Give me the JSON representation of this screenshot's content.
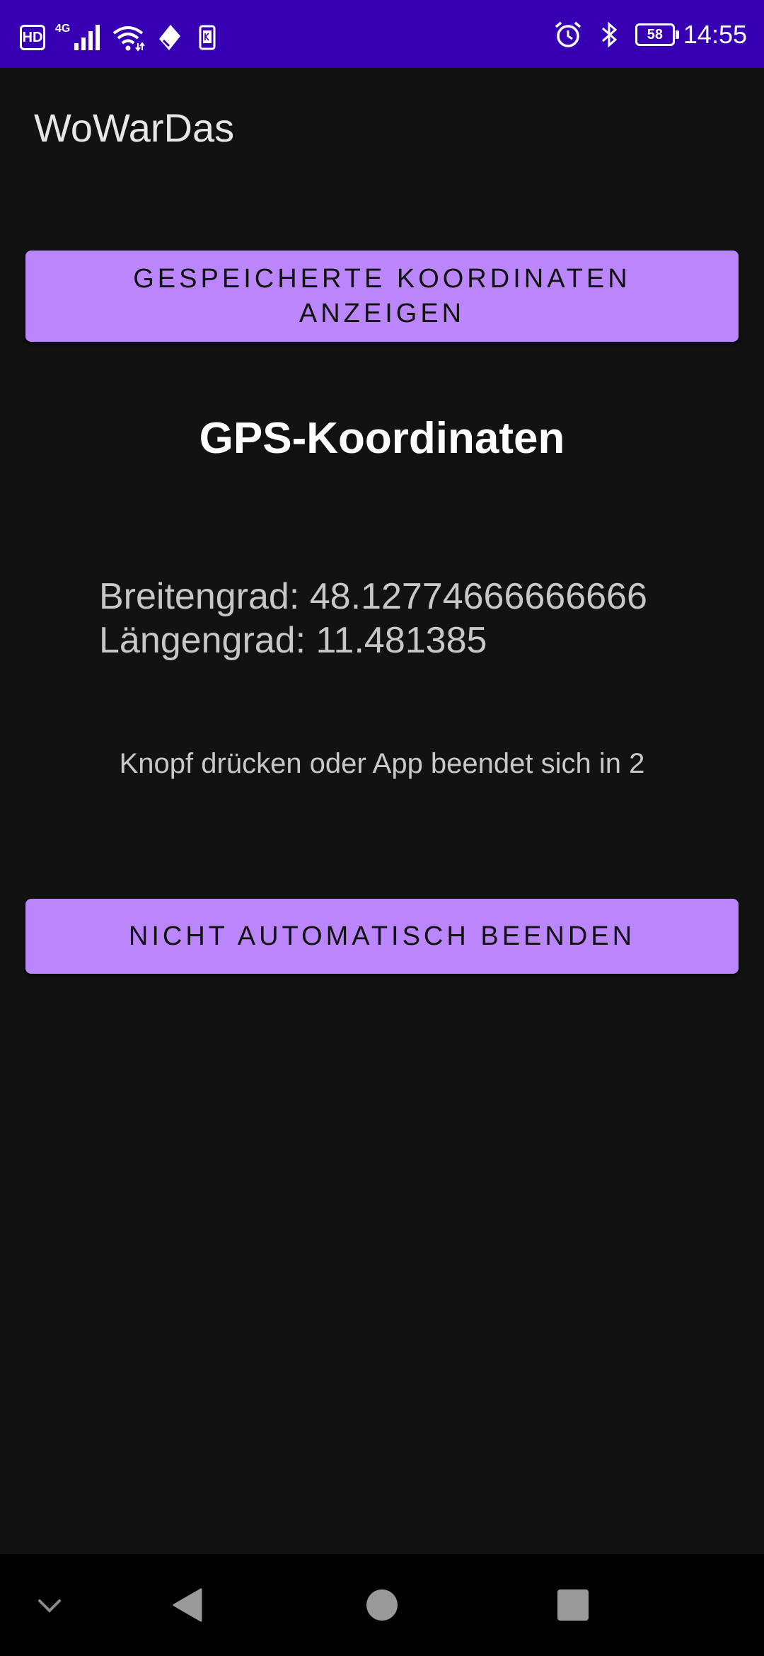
{
  "status_bar": {
    "hd_label": "HD",
    "network_label": "4G",
    "battery_level": "58",
    "time": "14:55",
    "icons": [
      "hd-icon",
      "signal-icon",
      "wifi-icon",
      "data-saver-icon",
      "sim-icon",
      "alarm-icon",
      "bluetooth-icon",
      "battery-icon"
    ]
  },
  "app_bar": {
    "title": "WoWarDas"
  },
  "main": {
    "saved_coordinates_button": "GESPEICHERTE KOORDINATEN ANZEIGEN",
    "heading": "GPS-Koordinaten",
    "latitude": "Breitengrad: 48.12774666666666",
    "longitude": "Längengrad: 11.481385",
    "countdown_text": "Knopf drücken oder App beendet sich in 2",
    "no_auto_exit_button": "NICHT AUTOMATISCH BEENDEN"
  },
  "nav_bar": {
    "icons": [
      "chevron-down-icon",
      "back-icon",
      "home-icon",
      "recents-icon"
    ]
  },
  "colors": {
    "status_bar": "#3700B3",
    "background": "#121212",
    "button": "#BB86FC",
    "nav_bar": "#000000"
  }
}
